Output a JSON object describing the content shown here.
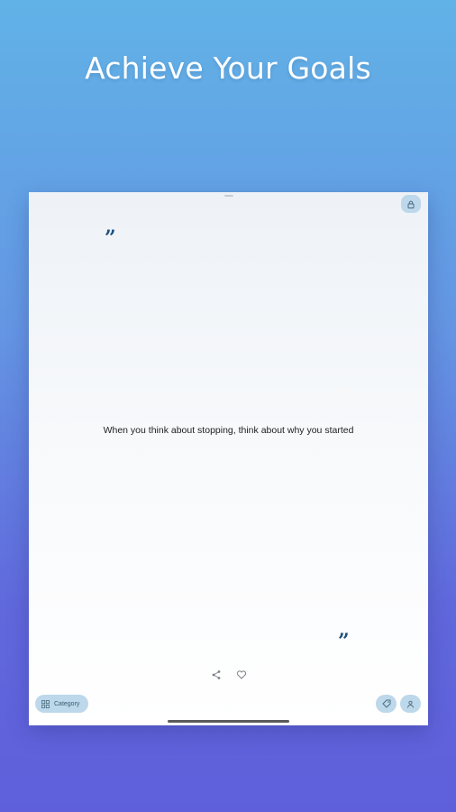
{
  "headline": "Achieve Your Goals",
  "quote": {
    "open_mark": "”",
    "text": "When you think about stopping, think about why you started",
    "close_mark": "”"
  },
  "toolbar": {
    "category_label": "Category",
    "icons": {
      "lock": "lock-icon",
      "share": "share-icon",
      "like": "heart-icon",
      "category": "grid-icon",
      "theme": "tag-icon",
      "profile": "person-icon"
    }
  },
  "colors": {
    "background_top": "#61b2e7",
    "background_bottom": "#5f5fdb",
    "quote_mark": "#1e4f7c",
    "button_fill": "#bcd8ea"
  }
}
